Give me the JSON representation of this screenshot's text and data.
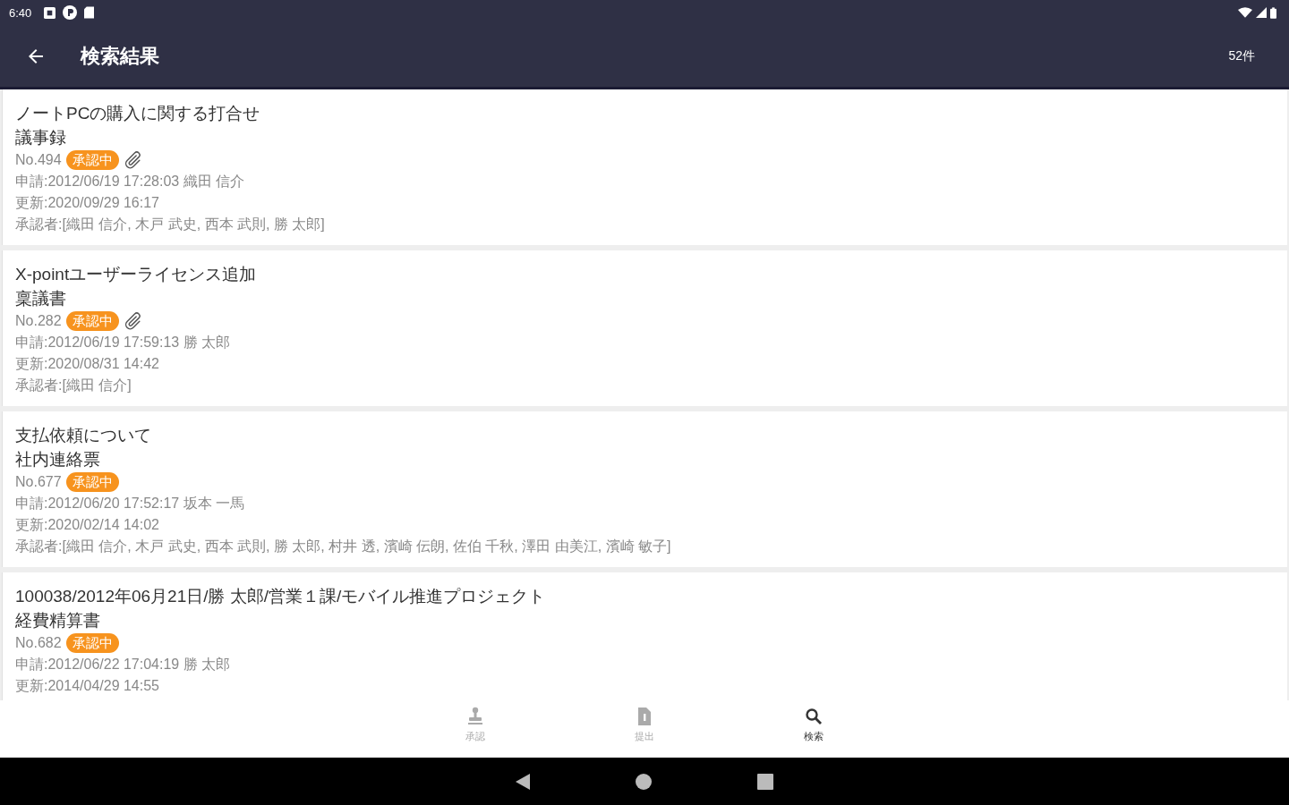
{
  "status_bar": {
    "time": "6:40"
  },
  "app_bar": {
    "title": "検索結果",
    "count": "52件"
  },
  "results": [
    {
      "title": "ノートPCの購入に関する打合せ",
      "form": "議事録",
      "number": "No.494",
      "status": "承認中",
      "attachment": true,
      "applied": "申請:2012/06/19 17:28:03 織田 信介",
      "updated": "更新:2020/09/29 16:17",
      "approvers": "承認者:[織田 信介, 木戸 武史, 西本 武則, 勝 太郎]"
    },
    {
      "title": "X-pointユーザーライセンス追加",
      "form": "稟議書",
      "number": "No.282",
      "status": "承認中",
      "attachment": true,
      "applied": "申請:2012/06/19 17:59:13 勝 太郎",
      "updated": "更新:2020/08/31 14:42",
      "approvers": "承認者:[織田 信介]"
    },
    {
      "title": "支払依頼について",
      "form": "社内連絡票",
      "number": "No.677",
      "status": "承認中",
      "attachment": false,
      "applied": "申請:2012/06/20 17:52:17 坂本 一馬",
      "updated": "更新:2020/02/14 14:02",
      "approvers": "承認者:[織田 信介, 木戸 武史, 西本 武則, 勝 太郎, 村井 透, 濱崎 伝朗, 佐伯 千秋, 澤田 由美江, 濱崎 敏子]"
    },
    {
      "title": "100038/2012年06月21日/勝 太郎/営業１課/モバイル推進プロジェクト",
      "form": "経費精算書",
      "number": "No.682",
      "status": "承認中",
      "attachment": false,
      "applied": "申請:2012/06/22 17:04:19 勝 太郎",
      "updated": "更新:2014/04/29 14:55"
    }
  ],
  "bottom_nav": [
    {
      "label": "承認",
      "selected": false
    },
    {
      "label": "提出",
      "selected": false
    },
    {
      "label": "検索",
      "selected": true
    }
  ]
}
